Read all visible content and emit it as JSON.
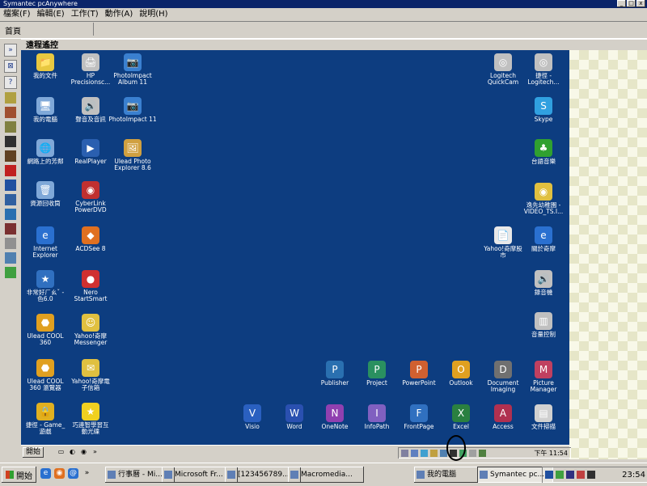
{
  "window": {
    "title": "Symantec pcAnywhere",
    "minimize": "_",
    "maximize": "□",
    "close": "x"
  },
  "menu": [
    "檔案(F)",
    "編輯(E)",
    "工作(T)",
    "動作(A)",
    "說明(H)"
  ],
  "address": "首頁",
  "remote_header": "遠程遙控",
  "desktop_icons": [
    {
      "label": "我的文件",
      "color": "#e8c840",
      "glyph": "📁"
    },
    {
      "label": "HP\nPrecisionsc...",
      "color": "#c0c0c0",
      "glyph": "🖨"
    },
    {
      "label": "PhotoImpact\nAlbum 11",
      "color": "#3a80d0",
      "glyph": "📷"
    },
    {
      "label": "我的電腦",
      "color": "#7fa8d8",
      "glyph": "🖥"
    },
    {
      "label": "聲音及音訊",
      "color": "#c0c0c0",
      "glyph": "🔊"
    },
    {
      "label": "PhotoImpact 11",
      "color": "#3a80d0",
      "glyph": "📷"
    },
    {
      "label": "網路上的芳鄰",
      "color": "#7fa8d8",
      "glyph": "🌐"
    },
    {
      "label": "RealPlayer",
      "color": "#2a5fb0",
      "glyph": "▶"
    },
    {
      "label": "Ulead Photo\nExplorer 8.6",
      "color": "#d0a040",
      "glyph": "🖼"
    },
    {
      "label": "資源回收筒",
      "color": "#7fa8d8",
      "glyph": "🗑"
    },
    {
      "label": "CyberLink\nPowerDVD",
      "color": "#c03030",
      "glyph": "◉"
    },
    {
      "label": "Internet\nExplorer",
      "color": "#2a70d0",
      "glyph": "e"
    },
    {
      "label": "ACDSee 8",
      "color": "#e07020",
      "glyph": "◆"
    },
    {
      "label": "非常好ㄏㄠˇ -\n色6.0",
      "color": "#3070c0",
      "glyph": "★"
    },
    {
      "label": "Nero StartSmart",
      "color": "#d03030",
      "glyph": "●"
    },
    {
      "label": "Ulead COOL\n360",
      "color": "#e0a020",
      "glyph": "⬣"
    },
    {
      "label": "Yahoo!奇摩\nMessenger",
      "color": "#e0c040",
      "glyph": "☺"
    },
    {
      "label": "Ulead COOL\n360 瀏覽器",
      "color": "#e0a020",
      "glyph": "⬣"
    },
    {
      "label": "Yahoo!奇摩電\n子信箱",
      "color": "#e0c040",
      "glyph": "✉"
    },
    {
      "label": "捷徑 - Game_\n遊戲",
      "color": "#e0b020",
      "glyph": "🔒"
    },
    {
      "label": "巧連智學習互\n動光碟",
      "color": "#f0d020",
      "glyph": "★"
    },
    {
      "label": "Publisher",
      "color": "#2a70b0",
      "glyph": "P"
    },
    {
      "label": "Project",
      "color": "#2a9060",
      "glyph": "P"
    },
    {
      "label": "PowerPoint",
      "color": "#d06030",
      "glyph": "P"
    },
    {
      "label": "Outlook",
      "color": "#e0a020",
      "glyph": "O"
    },
    {
      "label": "Document\nImaging",
      "color": "#707070",
      "glyph": "D"
    },
    {
      "label": "Picture\nManager",
      "color": "#c04060",
      "glyph": "M"
    },
    {
      "label": "Visio",
      "color": "#2a60c0",
      "glyph": "V"
    },
    {
      "label": "Word",
      "color": "#2a50b0",
      "glyph": "W"
    },
    {
      "label": "OneNote",
      "color": "#9040b0",
      "glyph": "N"
    },
    {
      "label": "InfoPath",
      "color": "#8060c0",
      "glyph": "I"
    },
    {
      "label": "FrontPage",
      "color": "#3070c0",
      "glyph": "F"
    },
    {
      "label": "Excel",
      "color": "#2a8040",
      "glyph": "X"
    },
    {
      "label": "Access",
      "color": "#b03050",
      "glyph": "A"
    },
    {
      "label": "文件掃描",
      "color": "#d0d0d0",
      "glyph": "▤"
    },
    {
      "label": "Logitech\nQuickCam",
      "color": "#c0c0c0",
      "glyph": "◎"
    },
    {
      "label": "捷徑 -\nLogitech...",
      "color": "#c0c0c0",
      "glyph": "◎"
    },
    {
      "label": "Skype",
      "color": "#30a0e0",
      "glyph": "S"
    },
    {
      "label": "台語音樂",
      "color": "#30a030",
      "glyph": "♣"
    },
    {
      "label": "逸先幼稚園 -\nVIDEO_TS.I...",
      "color": "#e0c040",
      "glyph": "◉"
    },
    {
      "label": "Yahoo!奇摩股\n市",
      "color": "#e8e8e8",
      "glyph": "📄"
    },
    {
      "label": "關於奇摩",
      "color": "#2a70d0",
      "glyph": "e"
    },
    {
      "label": "錄音機",
      "color": "#c0c0c0",
      "glyph": "🔊"
    },
    {
      "label": "音量控制",
      "color": "#c0c0c0",
      "glyph": "▥"
    }
  ],
  "remote_taskbar": {
    "start": "開始",
    "clock": "下午 11:54"
  },
  "taskbar": {
    "start": "開始",
    "tasks": [
      "行事曆 - Mi...",
      "Microsoft Fr...",
      "[123456789...",
      "Macromedia...",
      "我的電腦",
      "Symantec pc..."
    ],
    "active_task": "Symantec pc...",
    "clock": "23:54"
  }
}
